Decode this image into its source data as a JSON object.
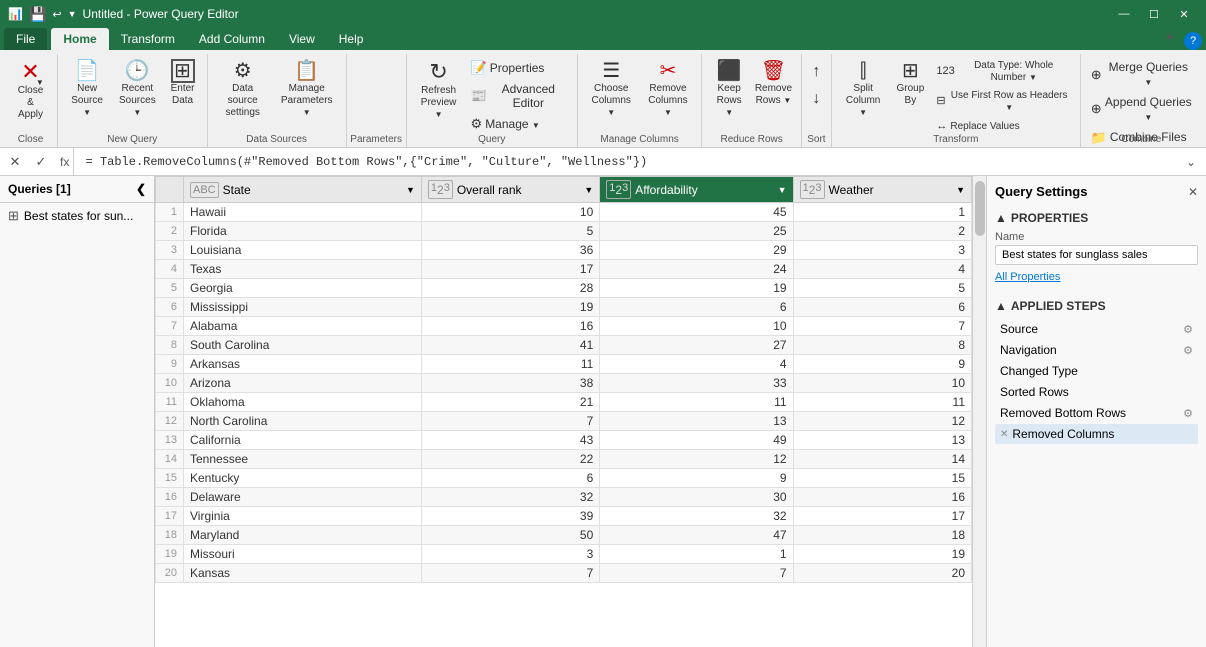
{
  "titleBar": {
    "icon": "📊",
    "title": "Untitled - Power Query Editor",
    "controls": [
      "—",
      "☐",
      "✕"
    ]
  },
  "ribbonTabs": [
    "File",
    "Home",
    "Transform",
    "Add Column",
    "View",
    "Help"
  ],
  "activeTab": "Home",
  "ribbonGroups": {
    "close": {
      "label": "Close",
      "buttons": [
        {
          "id": "close-apply",
          "icon": "✕",
          "label": "Close &\nApply",
          "dropdown": true
        }
      ]
    },
    "newQuery": {
      "label": "New Query",
      "buttons": [
        {
          "id": "new-source",
          "icon": "📄",
          "label": "New\nSource",
          "dropdown": true
        },
        {
          "id": "recent-sources",
          "icon": "🕒",
          "label": "Recent\nSources",
          "dropdown": true
        },
        {
          "id": "enter-data",
          "icon": "⊞",
          "label": "Enter\nData"
        }
      ]
    },
    "dataSources": {
      "label": "Data Sources",
      "buttons": [
        {
          "id": "data-source-settings",
          "icon": "⚙",
          "label": "Data source\nsettings"
        },
        {
          "id": "manage-parameters",
          "icon": "📋",
          "label": "Manage\nParameters",
          "dropdown": true
        }
      ]
    },
    "parameters": {
      "label": "Parameters",
      "buttons": []
    },
    "query": {
      "label": "Query",
      "buttons": [
        {
          "id": "refresh-preview",
          "icon": "↻",
          "label": "Refresh\nPreview",
          "dropdown": true
        },
        {
          "id": "properties",
          "icon": "📝",
          "label": "Properties"
        },
        {
          "id": "advanced-editor",
          "icon": "📰",
          "label": "Advanced Editor"
        },
        {
          "id": "manage",
          "icon": "⚙",
          "label": "Manage",
          "dropdown": true
        }
      ]
    },
    "manageColumns": {
      "label": "Manage Columns",
      "buttons": [
        {
          "id": "choose-columns",
          "icon": "☰",
          "label": "Choose\nColumns",
          "dropdown": true
        },
        {
          "id": "remove-columns",
          "icon": "✂",
          "label": "Remove\nColumns",
          "dropdown": true
        }
      ]
    },
    "reduceRows": {
      "label": "Reduce Rows",
      "buttons": [
        {
          "id": "keep-rows",
          "icon": "⬛",
          "label": "Keep\nRows",
          "dropdown": true
        },
        {
          "id": "remove-rows",
          "icon": "🗑",
          "label": "Remove\nRows",
          "dropdown": true
        }
      ]
    },
    "sort": {
      "label": "Sort",
      "buttons": [
        {
          "id": "sort-asc",
          "icon": "↑",
          "label": ""
        },
        {
          "id": "sort-desc",
          "icon": "↓",
          "label": ""
        }
      ]
    },
    "transform": {
      "label": "Transform",
      "buttons": [
        {
          "id": "split-column",
          "icon": "⫿",
          "label": "Split\nColumn",
          "dropdown": true
        },
        {
          "id": "group-by",
          "icon": "⊞",
          "label": "Group\nBy"
        },
        {
          "id": "data-type",
          "label": "Data Type: Whole Number",
          "dropdown": true
        },
        {
          "id": "first-row-headers",
          "label": "Use First Row as Headers",
          "dropdown": true
        },
        {
          "id": "replace-values",
          "label": "Replace Values"
        }
      ]
    },
    "combine": {
      "label": "Combine",
      "buttons": [
        {
          "id": "merge-queries",
          "label": "Merge Queries",
          "dropdown": true
        },
        {
          "id": "append-queries",
          "label": "Append Queries",
          "dropdown": true
        },
        {
          "id": "combine-files",
          "label": "Combine Files"
        }
      ]
    }
  },
  "formulaBar": {
    "cancelBtn": "✕",
    "confirmBtn": "✓",
    "fxLabel": "fx",
    "formula": " = Table.RemoveColumns(#\"Removed Bottom Rows\",{\"Crime\", \"Culture\", \"Wellness\"})",
    "expandBtn": "⌄"
  },
  "leftSidebar": {
    "title": "Queries [1]",
    "collapseIcon": "❮",
    "items": [
      {
        "id": "best-states",
        "icon": "⊞",
        "label": "Best states for sun..."
      }
    ]
  },
  "columns": [
    {
      "id": "state",
      "type": "ABC",
      "label": "State",
      "highlighted": false
    },
    {
      "id": "overall-rank",
      "type": "123",
      "label": "Overall rank",
      "highlighted": false
    },
    {
      "id": "affordability",
      "type": "123",
      "label": "Affordability",
      "highlighted": true
    },
    {
      "id": "weather",
      "type": "123",
      "label": "Weather",
      "highlighted": false
    }
  ],
  "tableData": [
    {
      "row": 1,
      "state": "Hawaii",
      "overall": 10,
      "affordability": 45,
      "weather": 1
    },
    {
      "row": 2,
      "state": "Florida",
      "overall": 5,
      "affordability": 25,
      "weather": 2
    },
    {
      "row": 3,
      "state": "Louisiana",
      "overall": 36,
      "affordability": 29,
      "weather": 3
    },
    {
      "row": 4,
      "state": "Texas",
      "overall": 17,
      "affordability": 24,
      "weather": 4
    },
    {
      "row": 5,
      "state": "Georgia",
      "overall": 28,
      "affordability": 19,
      "weather": 5
    },
    {
      "row": 6,
      "state": "Mississippi",
      "overall": 19,
      "affordability": 6,
      "weather": 6
    },
    {
      "row": 7,
      "state": "Alabama",
      "overall": 16,
      "affordability": 10,
      "weather": 7
    },
    {
      "row": 8,
      "state": "South Carolina",
      "overall": 41,
      "affordability": 27,
      "weather": 8
    },
    {
      "row": 9,
      "state": "Arkansas",
      "overall": 11,
      "affordability": 4,
      "weather": 9
    },
    {
      "row": 10,
      "state": "Arizona",
      "overall": 38,
      "affordability": 33,
      "weather": 10
    },
    {
      "row": 11,
      "state": "Oklahoma",
      "overall": 21,
      "affordability": 11,
      "weather": 11
    },
    {
      "row": 12,
      "state": "North Carolina",
      "overall": 7,
      "affordability": 13,
      "weather": 12
    },
    {
      "row": 13,
      "state": "California",
      "overall": 43,
      "affordability": 49,
      "weather": 13
    },
    {
      "row": 14,
      "state": "Tennessee",
      "overall": 22,
      "affordability": 12,
      "weather": 14
    },
    {
      "row": 15,
      "state": "Kentucky",
      "overall": 6,
      "affordability": 9,
      "weather": 15
    },
    {
      "row": 16,
      "state": "Delaware",
      "overall": 32,
      "affordability": 30,
      "weather": 16
    },
    {
      "row": 17,
      "state": "Virginia",
      "overall": 39,
      "affordability": 32,
      "weather": 17
    },
    {
      "row": 18,
      "state": "Maryland",
      "overall": 50,
      "affordability": 47,
      "weather": 18
    },
    {
      "row": 19,
      "state": "Missouri",
      "overall": 3,
      "affordability": 1,
      "weather": 19
    },
    {
      "row": 20,
      "state": "Kansas",
      "overall": 7,
      "affordability": 7,
      "weather": 20
    }
  ],
  "rightSidebar": {
    "title": "Query Settings",
    "closeIcon": "✕",
    "properties": {
      "sectionLabel": "PROPERTIES",
      "nameLabel": "Name",
      "nameValue": "Best states for sunglass sales",
      "allPropertiesLabel": "All Properties"
    },
    "appliedSteps": {
      "sectionLabel": "APPLIED STEPS",
      "steps": [
        {
          "id": "source",
          "label": "Source",
          "hasGear": true,
          "hasX": false,
          "active": false
        },
        {
          "id": "navigation",
          "label": "Navigation",
          "hasGear": true,
          "hasX": false,
          "active": false
        },
        {
          "id": "changed-type",
          "label": "Changed Type",
          "hasGear": false,
          "hasX": false,
          "active": false
        },
        {
          "id": "sorted-rows",
          "label": "Sorted Rows",
          "hasGear": false,
          "hasX": false,
          "active": false
        },
        {
          "id": "removed-bottom-rows",
          "label": "Removed Bottom Rows",
          "hasGear": true,
          "hasX": false,
          "active": false
        },
        {
          "id": "removed-columns",
          "label": "Removed Columns",
          "hasGear": false,
          "hasX": true,
          "active": true
        }
      ]
    }
  },
  "colors": {
    "accent": "#217346",
    "highlight": "#217346",
    "linkColor": "#0078d4",
    "activeStep": "#dce9f5"
  }
}
